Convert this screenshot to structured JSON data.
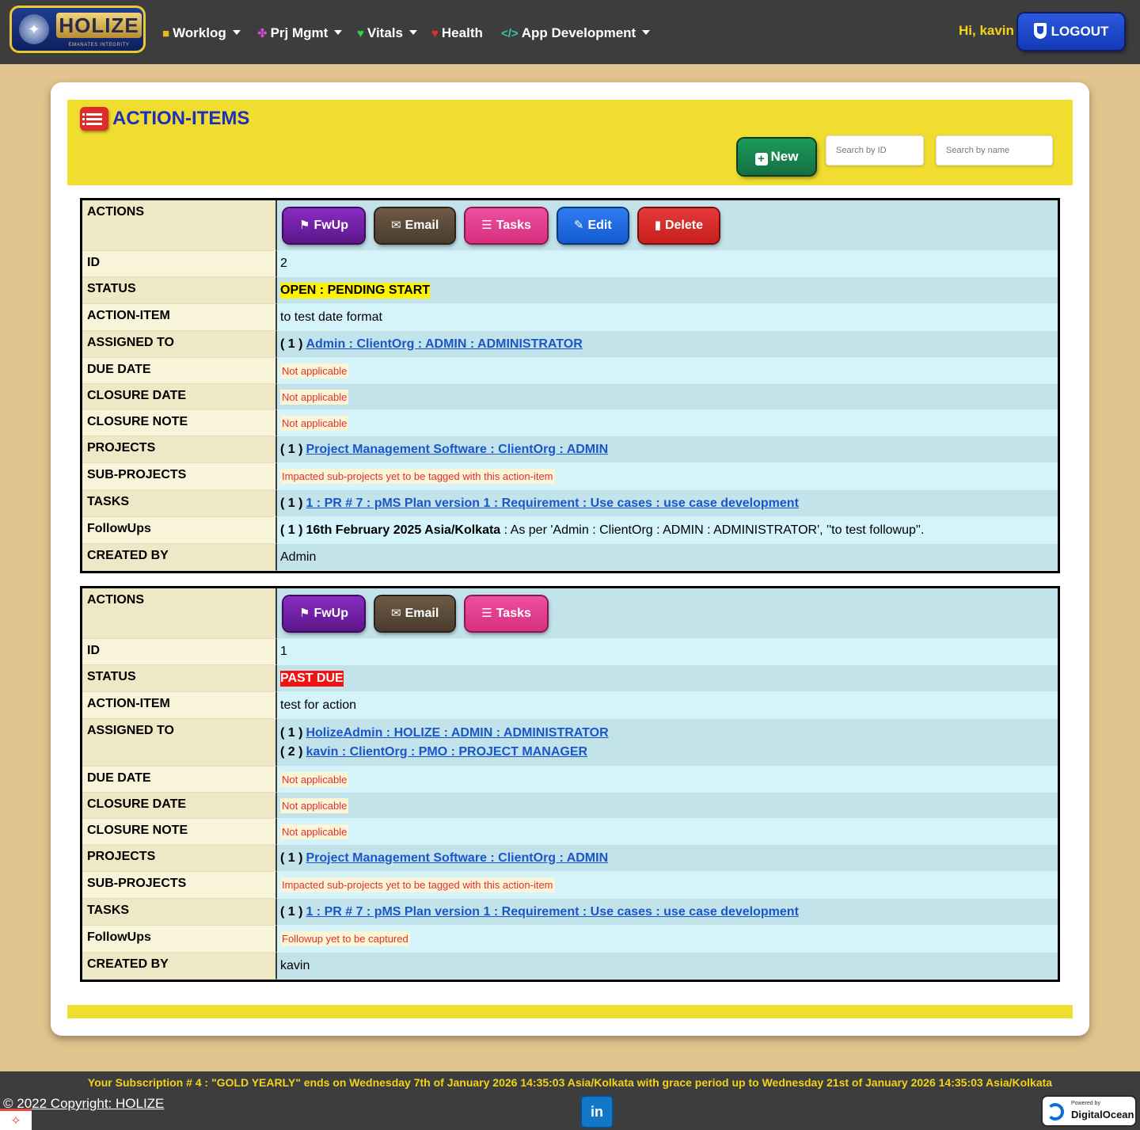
{
  "brand": {
    "name": "HOLIZE",
    "tagline": "EMANATES INTEGRITY"
  },
  "nav": [
    {
      "label": "Worklog",
      "icon": "briefcase-icon",
      "dropdown": true
    },
    {
      "label": "Prj Mgmt",
      "icon": "project-icon",
      "dropdown": true
    },
    {
      "label": "Vitals",
      "icon": "heart-pulse-icon",
      "dropdown": true
    },
    {
      "label": "Health",
      "icon": "health-icon",
      "dropdown": false
    },
    {
      "label": "App Development",
      "icon": "code-icon",
      "dropdown": true
    }
  ],
  "user": {
    "greeting": "Hi, kavin",
    "logout_label": "LOGOUT"
  },
  "page": {
    "title": "ACTION-ITEMS",
    "new_label": "New",
    "search_id_placeholder": "Search by ID",
    "search_name_placeholder": "Search by name"
  },
  "labels": {
    "actions": "ACTIONS",
    "id": "ID",
    "status": "STATUS",
    "action_item": "ACTION-ITEM",
    "assigned_to": "ASSIGNED TO",
    "due_date": "DUE DATE",
    "closure_date": "CLOSURE DATE",
    "closure_note": "CLOSURE NOTE",
    "projects": "PROJECTS",
    "sub_projects": "SUB-PROJECTS",
    "tasks": "TASKS",
    "followups": "FollowUps",
    "created_by": "CREATED BY"
  },
  "buttons": {
    "fwup": "FwUp",
    "email": "Email",
    "tasks": "Tasks",
    "edit": "Edit",
    "delete": "Delete"
  },
  "records": [
    {
      "id": "2",
      "status": "OPEN : PENDING START",
      "action_item": "to test date format",
      "assigned": [
        {
          "idx": "( 1 )",
          "text": "Admin : ClientOrg : ADMIN : ADMINISTRATOR"
        }
      ],
      "due_date": "Not applicable",
      "closure_date": "Not applicable",
      "closure_note": "Not applicable",
      "project": {
        "idx": "( 1 )",
        "text": "Project Management Software : ClientOrg : ADMIN"
      },
      "sub_projects": "Impacted sub-projects yet to be tagged with this action-item",
      "task": {
        "idx": "( 1 )",
        "text": "1 : PR # 7 : pMS Plan version 1 : Requirement : Use cases : use case development"
      },
      "followup": {
        "idx": "( 1 )",
        "date": "16th February 2025 Asia/Kolkata",
        "text": " : As per 'Admin : ClientOrg : ADMIN : ADMINISTRATOR', ''to test followup''."
      },
      "created_by": "Admin"
    },
    {
      "id": "1",
      "status": "PAST DUE",
      "action_item": "test for action",
      "assigned": [
        {
          "idx": "( 1 )",
          "text": "HolizeAdmin : HOLIZE : ADMIN : ADMINISTRATOR"
        },
        {
          "idx": "( 2 )",
          "text": "kavin : ClientOrg : PMO : PROJECT MANAGER"
        }
      ],
      "due_date": "Not applicable",
      "closure_date": "Not applicable",
      "closure_note": "Not applicable",
      "project": {
        "idx": "( 1 )",
        "text": "Project Management Software : ClientOrg : ADMIN"
      },
      "sub_projects": "Impacted sub-projects yet to be tagged with this action-item",
      "task": {
        "idx": "( 1 )",
        "text": "1 : PR # 7 : pMS Plan version 1 : Requirement : Use cases : use case development"
      },
      "followup_none": "Followup yet to be captured",
      "created_by": "kavin"
    }
  ],
  "footer": {
    "subscription": "Your Subscription # 4 : \"GOLD YEARLY\" ends on Wednesday 7th of January 2026 14:35:03 Asia/Kolkata with grace period up to Wednesday 21st of January 2026 14:35:03 Asia/Kolkata",
    "copyright": "© 2022 Copyright: HOLIZE",
    "linkedin": "in",
    "do_powered": "Powered by",
    "do_name": "DigitalOcean"
  },
  "colors": {
    "nav_bg": "#3d3d3d",
    "page_bg": "#e2c48f",
    "header_band": "#f0dd30",
    "title": "#1c2fbd",
    "link": "#1a56c9",
    "status_open": "#fff200",
    "status_past_due": "#f21212"
  }
}
